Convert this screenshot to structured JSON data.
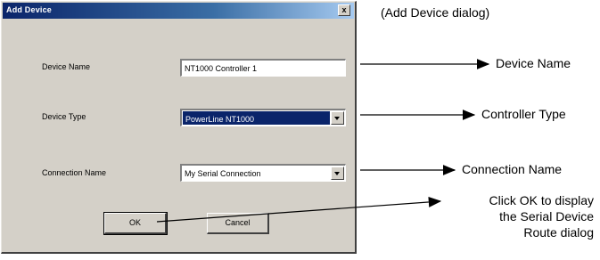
{
  "dialog": {
    "title": "Add Device",
    "close_label": "x",
    "fields": {
      "device_name": {
        "label": "Device Name",
        "value": "NT1000 Controller 1"
      },
      "device_type": {
        "label": "Device Type",
        "value": "PowerLine NT1000"
      },
      "connection_name": {
        "label": "Connection Name",
        "value": "My Serial Connection"
      }
    },
    "buttons": {
      "ok": "OK",
      "cancel": "Cancel"
    }
  },
  "annotations": {
    "caption": "(Add Device dialog)",
    "device_name": "Device Name",
    "controller_type": "Controller Type",
    "connection_name": "Connection Name",
    "ok_line1": "Click OK to display",
    "ok_line2": "the Serial Device",
    "ok_line3": "Route dialog"
  },
  "colors": {
    "titlebar": "#0a246a",
    "dialog_face": "#d4d0c8",
    "selection": "#0a246a"
  }
}
